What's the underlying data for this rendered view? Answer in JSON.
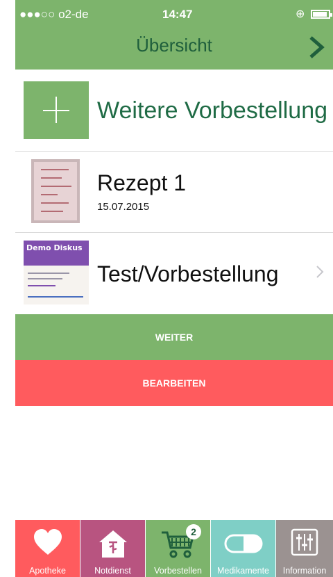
{
  "status_bar": {
    "carrier": "●●●○○ o2-de",
    "time": "14:47"
  },
  "header": {
    "title": "Übersicht"
  },
  "list": {
    "add_row": {
      "label": "Weitere Vorbestellung"
    },
    "items": [
      {
        "title": "Rezept 1",
        "date": "15.07.2015"
      },
      {
        "title": "Test/Vorbestellung",
        "thumb_brand": "Demo Diskus"
      }
    ]
  },
  "actions": {
    "primary": "WEITER",
    "secondary": "BEARBEITEN"
  },
  "tabs": [
    {
      "label": "Apotheke",
      "icon": "heart-icon",
      "color": "#ff5b5e"
    },
    {
      "label": "Notdienst",
      "icon": "pharmacy-icon",
      "color": "#b85480"
    },
    {
      "label": "Vorbestellen",
      "icon": "cart-icon",
      "color": "#7db46c",
      "badge": "2"
    },
    {
      "label": "Medikamente",
      "icon": "pill-icon",
      "color": "#7fcfc6"
    },
    {
      "label": "Information",
      "icon": "sliders-icon",
      "color": "#9b9291"
    }
  ],
  "colors": {
    "accent": "#7db46c",
    "danger": "#ff5b5e",
    "title_text": "#1f5f3c"
  }
}
